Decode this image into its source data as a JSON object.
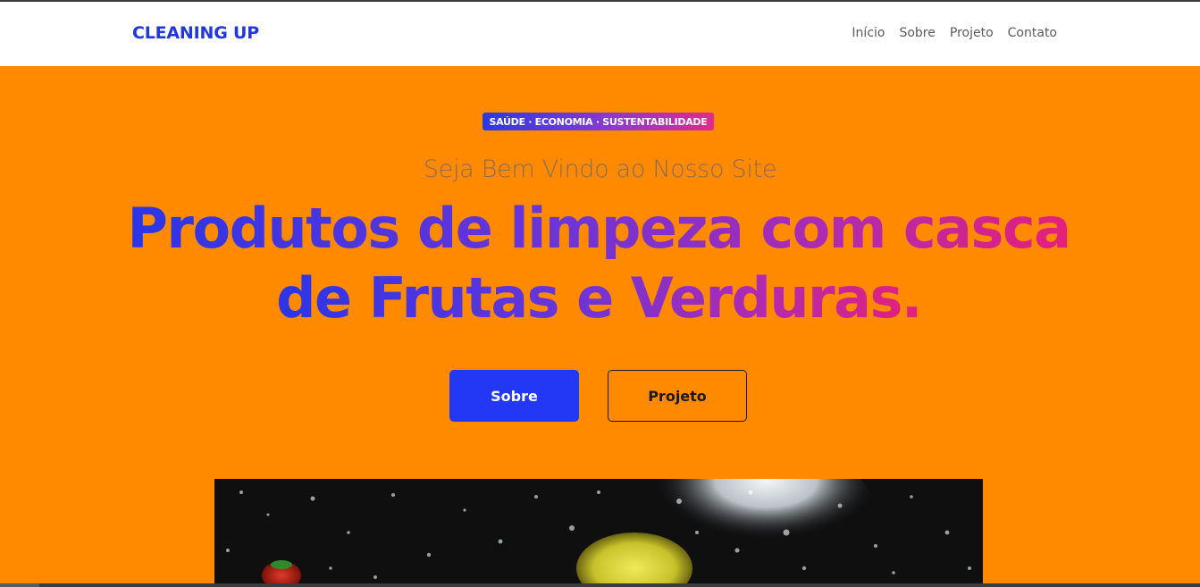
{
  "brand": {
    "name": "CLEANING UP",
    "color": "#2137e0"
  },
  "nav": {
    "items": [
      {
        "label": "Início"
      },
      {
        "label": "Sobre"
      },
      {
        "label": "Projeto"
      },
      {
        "label": "Contato"
      }
    ]
  },
  "hero": {
    "background": "#ff8a00",
    "badge": "SAÚDE · ECONOMIA · SUSTENTABILIDADE",
    "welcome": "Seja Bem Vindo ao Nosso Site",
    "headline": "Produtos de limpeza com casca de Frutas e Verduras.",
    "buttons": {
      "primary_label": "Sobre",
      "secondary_label": "Projeto"
    },
    "colors": {
      "primary": "#2238f5",
      "gradient_start": "#2b35e8",
      "gradient_end": "#e6207a"
    }
  }
}
